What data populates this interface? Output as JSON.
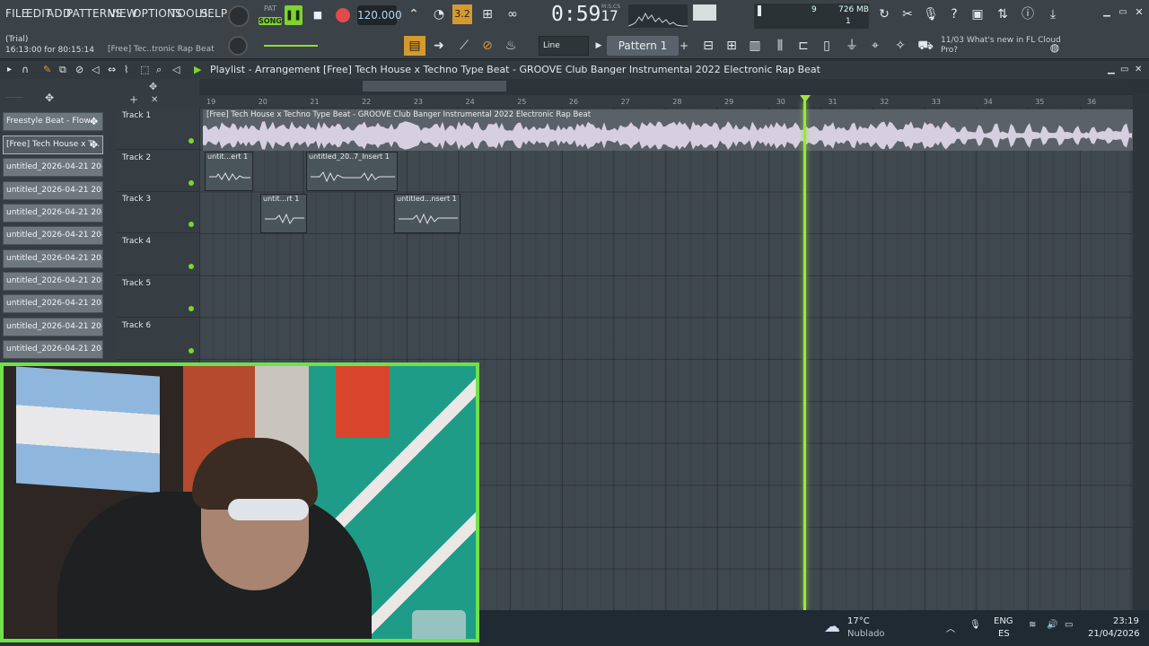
{
  "menu": [
    "FILE",
    "EDIT",
    "ADD",
    "PATTERNS",
    "VIEW",
    "OPTIONS",
    "TOOLS",
    "HELP"
  ],
  "transport": {
    "song_label": "SONG",
    "tempo": "120.000",
    "time": "0:59",
    "time_frac": "17",
    "time_unit": "M:S:CS"
  },
  "cpu": {
    "mb": "726 MB",
    "voices": "9",
    "cpu": "1"
  },
  "hint": {
    "line1": "(Trial)",
    "line2": "16:13:00 for 80:15:14",
    "line3": "[Free] Tec..tronic Rap Beat"
  },
  "snap": "Line",
  "pattern": "Pattern 1",
  "news": {
    "date": "11/03",
    "text": "What's new in FL Cloud Pro?"
  },
  "playlist": {
    "title": "Playlist - Arrangement",
    "song": "[Free] Tech House x Techno Type Beat - GROOVE  Club Banger Instrumental 2022  Electronic Rap Beat"
  },
  "browser": [
    "Freestyle Beat - Flow...",
    "[Free] Tech House x T...",
    "untitled_2026-04-21 20-...",
    "untitled_2026-04-21 20-...",
    "untitled_2026-04-21 20-...",
    "untitled_2026-04-21 20-...",
    "untitled_2026-04-21 20-...",
    "untitled_2026-04-21 20-...",
    "untitled_2026-04-21 20-...",
    "untitled_2026-04-21 20-...",
    "untitled_2026-04-21 20-..."
  ],
  "tracks": [
    "Track 1",
    "Track 2",
    "Track 3",
    "Track 4",
    "Track 5",
    "Track 6"
  ],
  "ruler": [
    "19",
    "20",
    "21",
    "22",
    "23",
    "24",
    "25",
    "26",
    "27",
    "28",
    "29",
    "30",
    "31",
    "32",
    "33",
    "34",
    "35",
    "36"
  ],
  "clips": [
    {
      "name": "[Free] Tech House x Techno Type Beat - GROOVE  Club Banger Instrumental 2022  Electronic Rap Beat"
    },
    {
      "name": "untit...ert 1"
    },
    {
      "name": "untitled_20..7_Insert 1"
    },
    {
      "name": "untit...rt 1"
    },
    {
      "name": "untitled...nsert 1"
    }
  ],
  "taskbar": {
    "temp": "17°C",
    "weather": "Nublado",
    "lang1": "ENG",
    "lang2": "ES",
    "time": "23:19",
    "date": "21/04/2026"
  }
}
